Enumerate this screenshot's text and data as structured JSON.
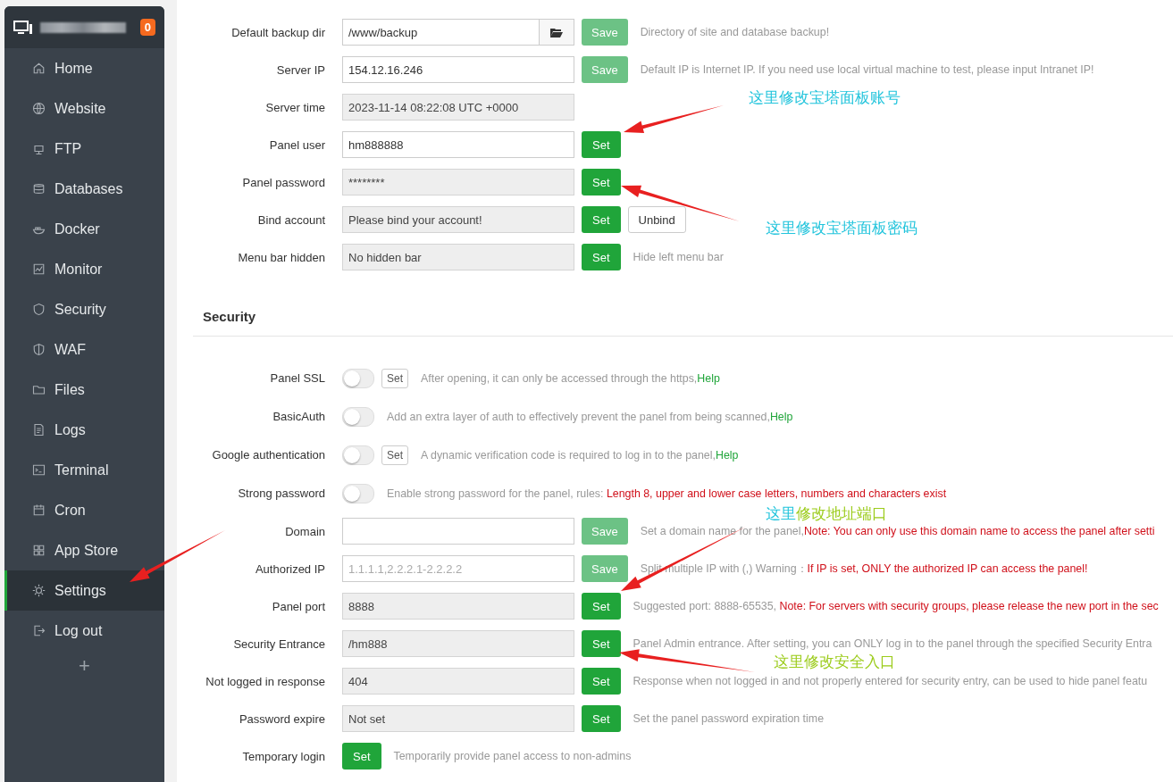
{
  "sidebar": {
    "badge": "0",
    "items": [
      {
        "label": "Home",
        "selected": false
      },
      {
        "label": "Website",
        "selected": false
      },
      {
        "label": "FTP",
        "selected": false
      },
      {
        "label": "Databases",
        "selected": false
      },
      {
        "label": "Docker",
        "selected": false
      },
      {
        "label": "Monitor",
        "selected": false
      },
      {
        "label": "Security",
        "selected": false
      },
      {
        "label": "WAF",
        "selected": false
      },
      {
        "label": "Files",
        "selected": false
      },
      {
        "label": "Logs",
        "selected": false
      },
      {
        "label": "Terminal",
        "selected": false
      },
      {
        "label": "Cron",
        "selected": false
      },
      {
        "label": "App Store",
        "selected": false
      },
      {
        "label": "Settings",
        "selected": true
      },
      {
        "label": "Log out",
        "selected": false
      }
    ],
    "add_label": "+"
  },
  "panel_rows": [
    {
      "label": "Default backup dir",
      "field": {
        "value": "/www/backup",
        "readonly": false,
        "folder": true
      },
      "buttons": [
        {
          "label": "Save",
          "kind": "save"
        }
      ],
      "hint": [
        {
          "text": "Directory of site and database backup!",
          "kind": "plain"
        }
      ]
    },
    {
      "label": "Server IP",
      "field": {
        "value": "154.12.16.246",
        "readonly": false
      },
      "buttons": [
        {
          "label": "Save",
          "kind": "save"
        }
      ],
      "hint": [
        {
          "text": "Default IP is Internet IP. If you need use local virtual machine to test, please input Intranet IP!",
          "kind": "plain"
        }
      ]
    },
    {
      "label": "Server time",
      "field": {
        "value": "2023-11-14 08:22:08 UTC +0000",
        "readonly": true
      },
      "buttons": [],
      "hint": []
    },
    {
      "label": "Panel user",
      "field": {
        "value": "hm888888",
        "readonly": false
      },
      "buttons": [
        {
          "label": "Set",
          "kind": "set"
        }
      ],
      "hint": []
    },
    {
      "label": "Panel password",
      "field": {
        "value": "********",
        "readonly": true
      },
      "buttons": [
        {
          "label": "Set",
          "kind": "set"
        }
      ],
      "hint": []
    },
    {
      "label": "Bind account",
      "field": {
        "value": "Please bind your account!",
        "readonly": true
      },
      "buttons": [
        {
          "label": "Set",
          "kind": "set"
        },
        {
          "label": "Unbind",
          "kind": "plain"
        }
      ],
      "hint": []
    },
    {
      "label": "Menu bar hidden",
      "field": {
        "value": "No hidden bar",
        "readonly": true
      },
      "buttons": [
        {
          "label": "Set",
          "kind": "set"
        }
      ],
      "hint": [
        {
          "text": "Hide left menu bar",
          "kind": "plain"
        }
      ]
    }
  ],
  "security": {
    "title": "Security",
    "rows": [
      {
        "label": "Panel SSL",
        "toggle": {
          "on": false
        },
        "buttons": [
          {
            "label": "Set",
            "kind": "small"
          }
        ],
        "hint": [
          {
            "text": "After opening, it can only be accessed through the https,",
            "kind": "plain"
          },
          {
            "text": "Help",
            "kind": "link"
          }
        ]
      },
      {
        "label": "BasicAuth",
        "toggle": {
          "on": false
        },
        "buttons": [],
        "hint": [
          {
            "text": "Add an extra layer of auth to effectively prevent the panel from being scanned,",
            "kind": "plain"
          },
          {
            "text": "Help",
            "kind": "link"
          }
        ]
      },
      {
        "label": "Google authentication",
        "toggle": {
          "on": false
        },
        "buttons": [
          {
            "label": "Set",
            "kind": "small"
          }
        ],
        "hint": [
          {
            "text": "A dynamic verification code is required to log in to the panel,",
            "kind": "plain"
          },
          {
            "text": "Help",
            "kind": "link"
          }
        ]
      },
      {
        "label": "Strong password",
        "toggle": {
          "on": false
        },
        "buttons": [],
        "hint": [
          {
            "text": "Enable strong password for the panel, rules: ",
            "kind": "plain"
          },
          {
            "text": "Length 8, upper and lower case letters, numbers and characters exist",
            "kind": "warn"
          }
        ]
      },
      {
        "label": "Domain",
        "field": {
          "readonly": false
        },
        "buttons": [
          {
            "label": "Save",
            "kind": "save"
          }
        ],
        "hint": [
          {
            "text": "Set a domain name for the panel,",
            "kind": "plain"
          },
          {
            "text": "Note: You can only use this domain name to access the panel after setti",
            "kind": "warn"
          }
        ]
      },
      {
        "label": "Authorized IP",
        "field": {
          "placeholder": "1.1.1.1,2.2.2.1-2.2.2.2",
          "readonly": false
        },
        "buttons": [
          {
            "label": "Save",
            "kind": "save"
          }
        ],
        "hint": [
          {
            "text": "Split multiple IP with (,) Warning：",
            "kind": "plain"
          },
          {
            "text": "If IP is set, ONLY the authorized IP can access the panel!",
            "kind": "warn"
          }
        ]
      },
      {
        "label": "Panel port",
        "field": {
          "value": "8888",
          "readonly": true
        },
        "buttons": [
          {
            "label": "Set",
            "kind": "set"
          }
        ],
        "hint": [
          {
            "text": "Suggested port: 8888-65535, ",
            "kind": "plain"
          },
          {
            "text": "Note: For servers with security groups, please release the new port in the sec",
            "kind": "warn"
          }
        ]
      },
      {
        "label": "Security Entrance",
        "field": {
          "value": "/hm888",
          "readonly": true
        },
        "buttons": [
          {
            "label": "Set",
            "kind": "set"
          }
        ],
        "hint": [
          {
            "text": "Panel Admin entrance. After setting, you can ONLY log in to the panel through the specified Security Entra",
            "kind": "plain"
          }
        ]
      },
      {
        "label": "Not logged in response",
        "field": {
          "value": "404",
          "readonly": true
        },
        "buttons": [
          {
            "label": "Set",
            "kind": "set"
          }
        ],
        "hint": [
          {
            "text": "Response when not logged in and not properly entered for security entry, can be used to hide panel featu",
            "kind": "plain"
          }
        ]
      },
      {
        "label": "Password expire",
        "field": {
          "value": "Not set",
          "readonly": true
        },
        "buttons": [
          {
            "label": "Set",
            "kind": "set"
          }
        ],
        "hint": [
          {
            "text": "Set the panel password expiration time",
            "kind": "plain"
          }
        ]
      },
      {
        "label": "Temporary login",
        "buttons": [
          {
            "label": "Set",
            "kind": "set"
          }
        ],
        "hint": [
          {
            "text": "Temporarily provide panel access to non-admins",
            "kind": "plain"
          }
        ]
      }
    ]
  },
  "callouts": [
    {
      "parts": [
        {
          "text": "这里修改宝塔面板账号",
          "color": "#22c4dc"
        }
      ]
    },
    {
      "parts": [
        {
          "text": "这里修改宝塔面板密码",
          "color": "#22c4dc"
        }
      ]
    },
    {
      "parts": [
        {
          "text": "这里",
          "color": "#22c4dc"
        },
        {
          "text": "修改地址端口",
          "color": "#9ccc1c"
        }
      ]
    },
    {
      "parts": [
        {
          "text": "这里修改安全入口",
          "color": "#9ccc1c"
        }
      ]
    }
  ]
}
